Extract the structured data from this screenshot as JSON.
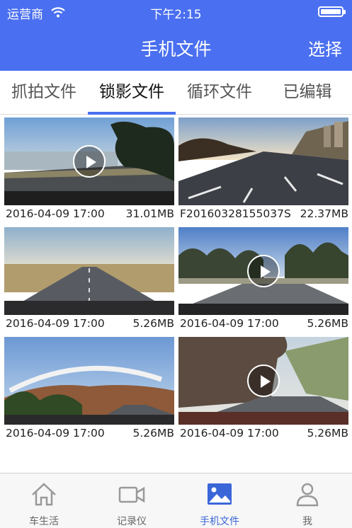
{
  "status_bar": {
    "carrier": "运营商",
    "time": "下午2:15"
  },
  "header": {
    "title": "手机文件",
    "select_label": "选择"
  },
  "tabs": [
    {
      "label": "抓拍文件"
    },
    {
      "label": "锁影文件"
    },
    {
      "label": "循环文件"
    },
    {
      "label": "已编辑"
    }
  ],
  "active_tab": "锁影文件",
  "files": [
    {
      "date": "2016-04-09 17:00",
      "size": "31.01MB",
      "has_play": true
    },
    {
      "date": "F20160328155037S",
      "size": "22.37MB",
      "has_play": false
    },
    {
      "date": "2016-04-09 17:00",
      "size": "5.26MB",
      "has_play": false
    },
    {
      "date": "2016-04-09 17:00",
      "size": "5.26MB",
      "has_play": true
    },
    {
      "date": "2016-04-09 17:00",
      "size": "5.26MB",
      "has_play": false
    },
    {
      "date": "2016-04-09 17:00",
      "size": "5.26MB",
      "has_play": true
    }
  ],
  "tab_bar": [
    {
      "label": "车生活",
      "icon": "home-icon"
    },
    {
      "label": "记录仪",
      "icon": "video-camera-icon"
    },
    {
      "label": "手机文件",
      "icon": "picture-icon"
    },
    {
      "label": "我",
      "icon": "person-icon"
    }
  ],
  "active_tab_bar": "手机文件",
  "colors": {
    "accent": "#4a6ff0",
    "active_icon": "#3a66d8"
  }
}
